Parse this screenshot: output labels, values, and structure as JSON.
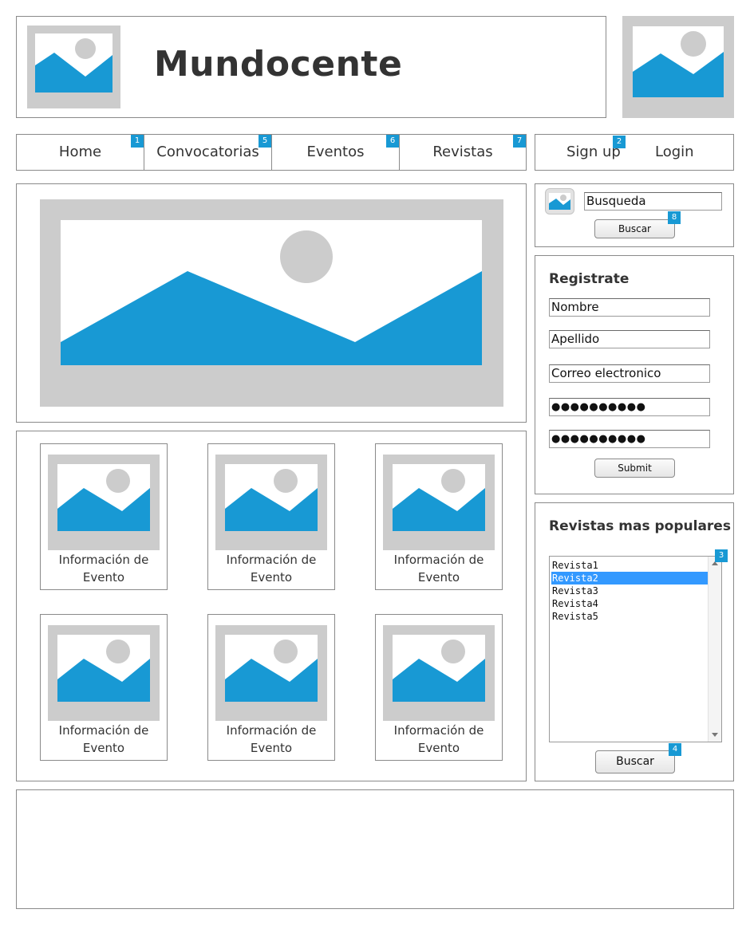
{
  "header": {
    "site_title": "Mundocente",
    "logo_icon": "image-placeholder-icon"
  },
  "nav": {
    "items": [
      {
        "label": "Home",
        "badge": "1"
      },
      {
        "label": "Convocatorias",
        "badge": "5"
      },
      {
        "label": "Eventos",
        "badge": "6"
      },
      {
        "label": "Revistas",
        "badge": "7"
      }
    ]
  },
  "auth": {
    "signup_label": "Sign up",
    "signup_badge": "2",
    "login_label": "Login"
  },
  "search": {
    "value": "Busqueda",
    "button_label": "Buscar",
    "badge": "8"
  },
  "register": {
    "heading": "Registrate",
    "fields": {
      "first_name": "Nombre",
      "last_name": "Apellido",
      "email": "Correo electronico",
      "password": "●●●●●●●●●●",
      "password_confirm": "●●●●●●●●●●"
    },
    "submit_label": "Submit"
  },
  "popular": {
    "heading": "Revistas mas populares",
    "items": [
      "Revista1",
      "Revista2",
      "Revista3",
      "Revista4",
      "Revista5"
    ],
    "selected_item": "Revista2",
    "list_badge": "3",
    "button_label": "Buscar",
    "button_badge": "4"
  },
  "events": {
    "cards": [
      {
        "line1": "Información de",
        "line2": "Evento"
      },
      {
        "line1": "Información de",
        "line2": "Evento"
      },
      {
        "line1": "Información de",
        "line2": "Evento"
      },
      {
        "line1": "Información de",
        "line2": "Evento"
      },
      {
        "line1": "Información de",
        "line2": "Evento"
      },
      {
        "line1": "Información de",
        "line2": "Evento"
      }
    ]
  },
  "colors": {
    "badge": "#1899d4",
    "placeholder_frame": "#cccccc",
    "mountain": "#1899d4",
    "selection": "#3399ff"
  }
}
